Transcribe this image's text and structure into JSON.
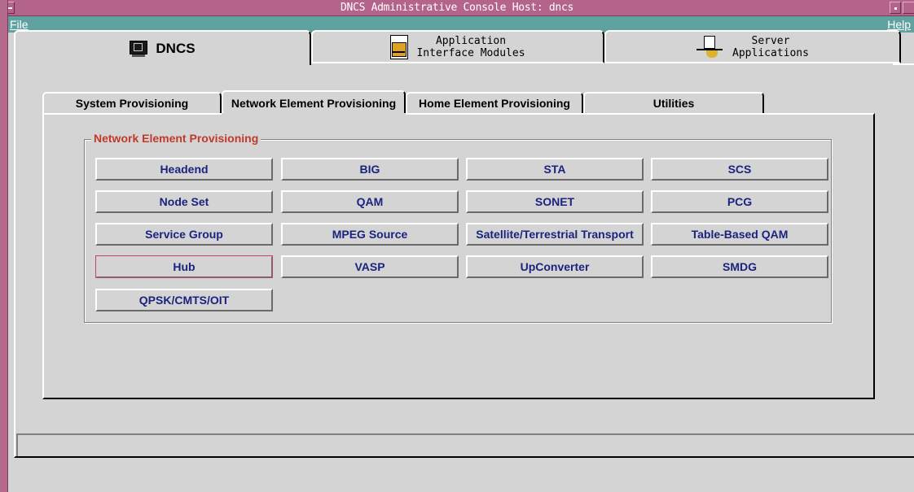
{
  "window": {
    "title": "DNCS Administrative Console   Host: dncs"
  },
  "menubar": {
    "file": "File",
    "help": "Help"
  },
  "top_tabs": [
    {
      "label": "DNCS",
      "icon": "monitor-icon",
      "selected": true
    },
    {
      "label": "Application\nInterface Modules",
      "icon": "document-icon",
      "selected": false
    },
    {
      "label": "Server\nApplications",
      "icon": "server-hand-icon",
      "selected": false
    }
  ],
  "sub_tabs": [
    {
      "label": "System Provisioning",
      "selected": false
    },
    {
      "label": "Network Element Provisioning",
      "selected": true
    },
    {
      "label": "Home Element Provisioning",
      "selected": false
    },
    {
      "label": "Utilities",
      "selected": false
    }
  ],
  "group": {
    "title": "Network Element Provisioning",
    "title_color": "#c0392b",
    "button_text_color": "#1a237e",
    "buttons": [
      "Headend",
      "BIG",
      "STA",
      "SCS",
      "Node Set",
      "QAM",
      "SONET",
      "PCG",
      "Service Group",
      "MPEG Source",
      "Satellite/Terrestrial Transport",
      "Table-Based QAM",
      "Hub",
      "VASP",
      "UpConverter",
      "SMDG",
      "QPSK/CMTS/OIT"
    ]
  },
  "colors": {
    "titlebar": "#b4648a",
    "menubar": "#5fa2a0",
    "background": "#d4d4d4"
  },
  "statusbar": {
    "text": ""
  }
}
